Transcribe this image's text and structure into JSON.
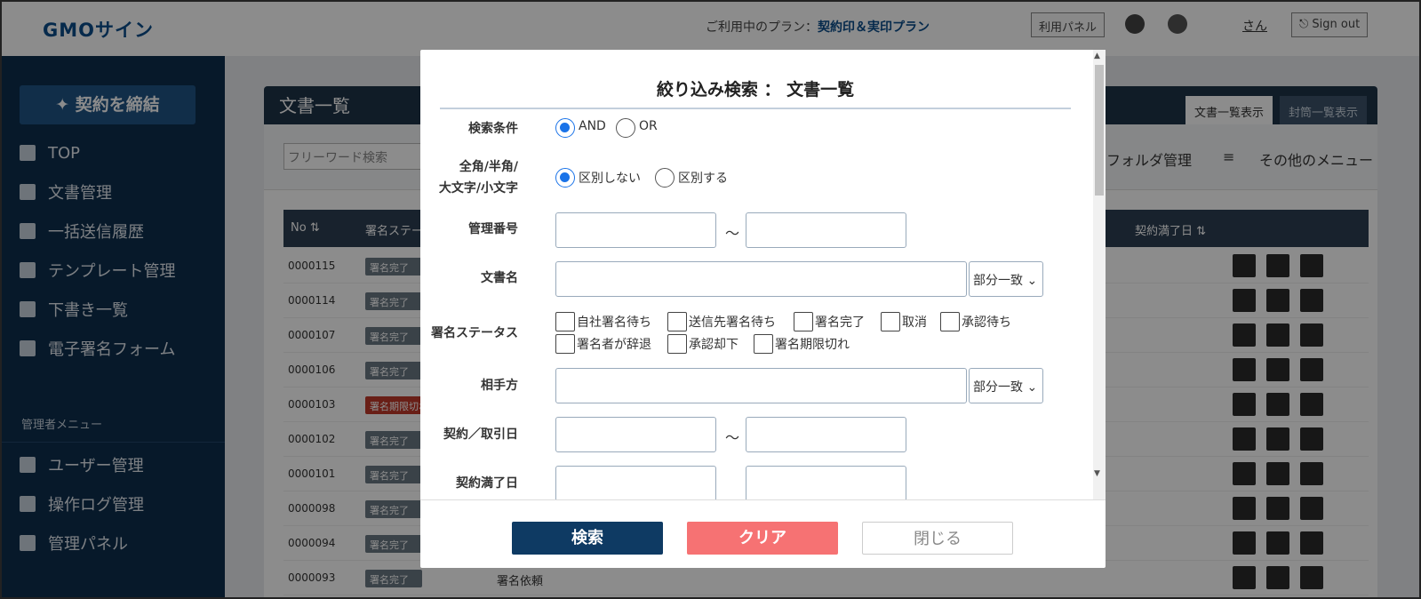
{
  "header": {
    "logo": "GMOサイン",
    "plan_label": "ご利用中のプラン：",
    "plan_name": "契約印＆実印プラン",
    "panel_button": "利用パネル",
    "user_name": "さん",
    "signout": "Sign out"
  },
  "sidebar": {
    "cta": "契約を締結",
    "items": [
      {
        "label": "TOP",
        "icon": "home-icon"
      },
      {
        "label": "文書管理",
        "icon": "document-icon"
      },
      {
        "label": "一括送信履歴",
        "icon": "batch-send-icon"
      },
      {
        "label": "テンプレート管理",
        "icon": "template-icon"
      },
      {
        "label": "下書き一覧",
        "icon": "draft-icon"
      },
      {
        "label": "電子署名フォーム",
        "icon": "link-icon"
      }
    ],
    "admin_title": "管理者メニュー",
    "admin_items": [
      {
        "label": "ユーザー管理",
        "icon": "user-icon"
      },
      {
        "label": "操作ログ管理",
        "icon": "log-icon"
      },
      {
        "label": "管理パネル",
        "icon": "admin-icon"
      }
    ]
  },
  "main": {
    "title": "文書一覧",
    "tabs": [
      "文書一覧表示",
      "封筒一覧表示"
    ],
    "search_placeholder": "フリーワード検索",
    "folder_link": "フォルダ管理",
    "menu_link": "その他のメニュー",
    "columns": {
      "no": "No",
      "status": "署名ステー",
      "expiry": "契約満了日"
    },
    "rows": [
      {
        "no": "0000115",
        "status": "署名完了",
        "alert": false
      },
      {
        "no": "0000114",
        "status": "署名完了",
        "alert": false
      },
      {
        "no": "0000107",
        "status": "署名完了",
        "alert": false
      },
      {
        "no": "0000106",
        "status": "署名完了",
        "alert": false
      },
      {
        "no": "0000103",
        "status": "署名期限切れ",
        "alert": true
      },
      {
        "no": "0000102",
        "status": "署名完了",
        "alert": false
      },
      {
        "no": "0000101",
        "status": "署名完了",
        "alert": false
      },
      {
        "no": "0000098",
        "status": "署名完了",
        "alert": false
      },
      {
        "no": "0000094",
        "status": "署名完了",
        "alert": false
      },
      {
        "no": "0000093",
        "status": "署名完了",
        "alert": false,
        "text": "署名依頼"
      }
    ]
  },
  "modal": {
    "title": "絞り込み検索 ： 文書一覧",
    "labels": {
      "condition": "検索条件",
      "width_line1": "全角/半角/",
      "width_line2": "大文字/小文字",
      "manage_no": "管理番号",
      "doc_name": "文書名",
      "sign_status": "署名ステータス",
      "partner": "相手方",
      "contract_date": "契約／取引日",
      "expiry_date": "契約満了日"
    },
    "condition_options": [
      "AND",
      "OR"
    ],
    "width_options": [
      "区別しない",
      "区別する"
    ],
    "match_select": "部分一致",
    "tilde": "～",
    "status_options": [
      "自社署名待ち",
      "送信先署名待ち",
      "署名完了",
      "取消",
      "承認待ち",
      "署名者が辞退",
      "承認却下",
      "署名期限切れ"
    ],
    "buttons": {
      "search": "検索",
      "clear": "クリア",
      "close": "閉じる"
    }
  }
}
